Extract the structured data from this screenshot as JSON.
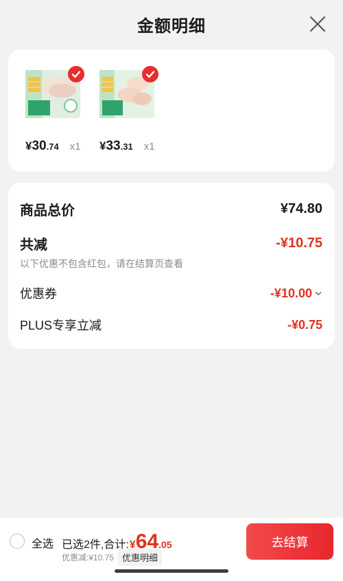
{
  "header": {
    "title": "金额明细",
    "close_icon": "close-icon"
  },
  "products": [
    {
      "price_yen": "¥",
      "price_int": "30",
      "price_dec": ".74",
      "qty": "x1",
      "selected": true
    },
    {
      "price_yen": "¥",
      "price_int": "33",
      "price_dec": ".31",
      "qty": "x1",
      "selected": true
    }
  ],
  "summary": {
    "total_label": "商品总价",
    "total_value": "¥74.80",
    "reduce_label": "共减",
    "reduce_value": "-¥10.75",
    "note": "以下优惠不包含红包，请在结算页查看",
    "coupon_label": "优惠券",
    "coupon_value": "-¥10.00",
    "plus_label": "PLUS专享立减",
    "plus_value": "-¥0.75"
  },
  "bottom": {
    "select_all": "全选",
    "selected_text": "已选2件,合计:",
    "total_yen": "¥",
    "total_int": "64",
    "total_dec": ".05",
    "discount_text": "优惠减:¥10.75",
    "detail_label": "优惠明细",
    "checkout_label": "去结算"
  },
  "colors": {
    "accent_red": "#e0321e",
    "checkout_red": "#f24a4a",
    "background": "#f2f2f2"
  }
}
